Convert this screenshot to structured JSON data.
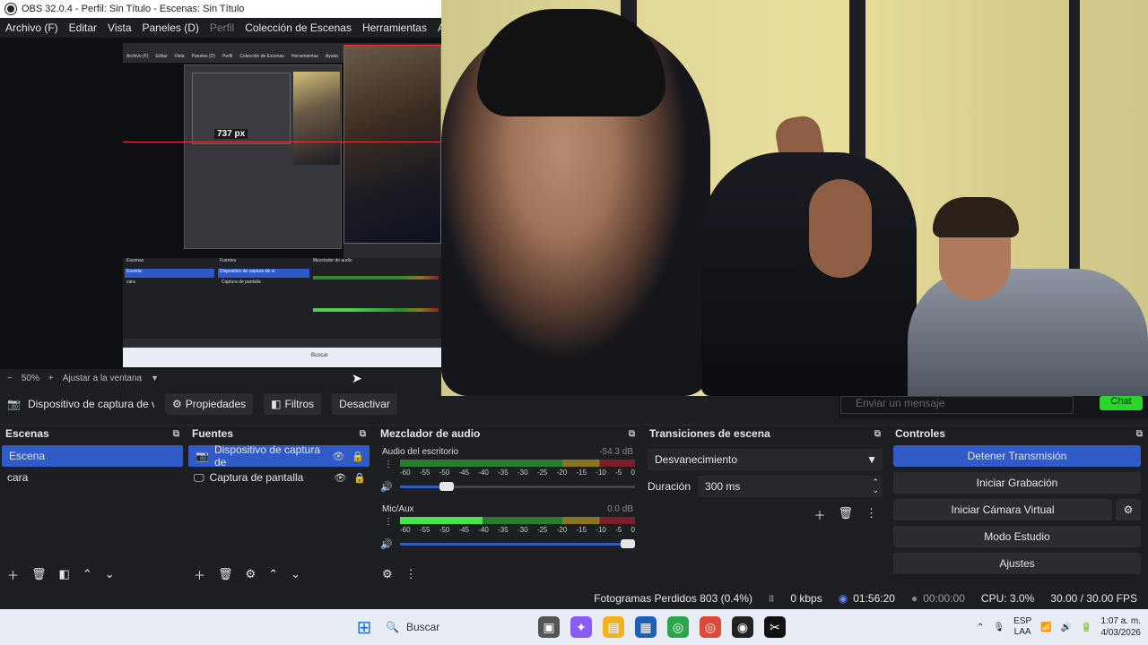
{
  "window": {
    "title": "OBS 32.0.4 - Perfil: Sin Título - Escenas: Sin Título"
  },
  "menu": [
    "Archivo (F)",
    "Editar",
    "Vista",
    "Paneles (D)",
    "Perfil",
    "Colección de Escenas",
    "Herramientas",
    "Ayuda"
  ],
  "preview": {
    "nested_measure": "737 px",
    "nested_menu": [
      "Archivo (F)",
      "Editar",
      "Vista",
      "Paneles (D)",
      "Perfil",
      "Colección de Escenas",
      "Herramientas",
      "Ayuda"
    ],
    "nested_scenes_label": "Escenas",
    "nested_sources_label": "Fuentes",
    "nested_mixer_label": "Mezclador de audio",
    "nested_scene_selected": "Escena",
    "nested_scene_other": "cara",
    "nested_source_1": "Dispositivo de captura de vi",
    "nested_source_2": "Captura de pantalla",
    "nested_search": "Buscar"
  },
  "zoombar": {
    "minus": "−",
    "zoom": "50%",
    "plus": "+",
    "fit": "Ajustar a la ventana"
  },
  "sourcebar": {
    "source_name": "Dispositivo de captura de v",
    "properties": "Propiedades",
    "filters": "Filtros",
    "deactivate": "Desactivar"
  },
  "chat": {
    "placeholder": "Enviar un mensaje",
    "button": "Chat"
  },
  "scenes": {
    "title": "Escenas",
    "items": [
      {
        "label": "Escena",
        "selected": true
      },
      {
        "label": "cara",
        "selected": false
      }
    ]
  },
  "sources": {
    "title": "Fuentes",
    "items": [
      {
        "label": "Dispositivo de captura de",
        "selected": true
      },
      {
        "label": "Captura de pantalla",
        "selected": false
      }
    ]
  },
  "mixer": {
    "title": "Mezclador de audio",
    "scale": [
      "-60",
      "-55",
      "-50",
      "-45",
      "-40",
      "-35",
      "-30",
      "-25",
      "-20",
      "-15",
      "-10",
      "-5",
      "0"
    ],
    "channels": [
      {
        "name": "Audio del escritorio",
        "db": "-54.3 dB",
        "level": 0.0,
        "volume": 0.2
      },
      {
        "name": "Mic/Aux",
        "db": "0.0 dB",
        "level": 0.35,
        "volume": 1.0
      }
    ]
  },
  "transitions": {
    "title": "Transiciones de escena",
    "selected": "Desvanecimiento",
    "duration_label": "Duración",
    "duration_value": "300 ms"
  },
  "controls": {
    "title": "Controles",
    "stop_stream": "Detener Transmisión",
    "start_recording": "Iniciar Grabación",
    "virtual_camera": "Iniciar Cámara Virtual",
    "studio_mode": "Modo Estudio",
    "settings": "Ajustes"
  },
  "status": {
    "dropped_frames": "Fotogramas Perdidos 803 (0.4%)",
    "bitrate": "0 kbps",
    "stream_time": "01:56:20",
    "record_time": "00:00:00",
    "cpu": "CPU: 3.0%",
    "fps": "30.00 / 30.00 FPS"
  },
  "taskbar": {
    "search_placeholder": "Buscar",
    "lang_1": "ESP",
    "lang_2": "LAA",
    "time": "1:07 a. m.",
    "date": "4/03/2026"
  },
  "colors": {
    "accent": "#2f5ac8",
    "panel_bg": "#1d1e22",
    "meter_green": "#4ee14e",
    "chat_green": "#2bd62b"
  }
}
